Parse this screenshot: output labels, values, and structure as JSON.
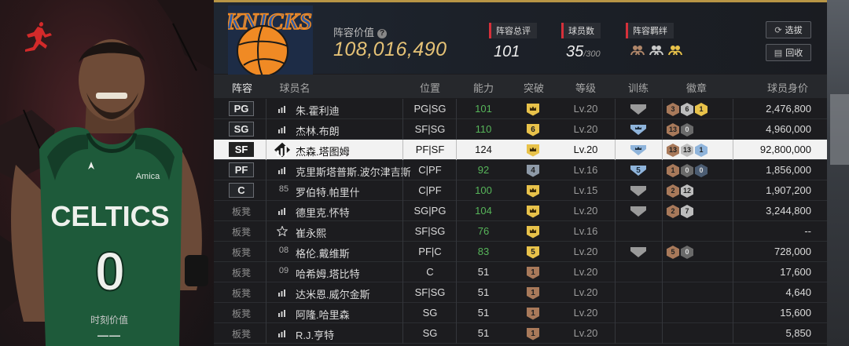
{
  "player_panel": {
    "moment_value_label": "时刻价值",
    "moment_value": "——",
    "jersey_text": "CELTICS",
    "jersey_number": "0",
    "sponsor": "Amica"
  },
  "header": {
    "team_logo_text": "KNICKS",
    "lineup_value_label": "阵容价值",
    "lineup_value": "108,016,490",
    "overall_label": "阵容总评",
    "overall_value": "101",
    "players_label": "球员数",
    "players_count": "35",
    "players_max": "/300",
    "synergy_label": "阵容羁绊",
    "select_button": "选拔",
    "back_button": "回收"
  },
  "columns": [
    "阵容",
    "球员名",
    "位置",
    "能力",
    "突破",
    "等级",
    "训练",
    "徽章",
    "球员身价"
  ],
  "rows": [
    {
      "slot": "PG",
      "slot_type": "starter",
      "icon": "tier",
      "name": "朱.霍利迪",
      "position": "PG|SG",
      "ability": "101",
      "ability_green": true,
      "breakthrough": "",
      "bt_color": "gold",
      "level": "Lv.20",
      "train": "",
      "train_color": "gray",
      "badges": [
        {
          "t": "3",
          "c": "bronze"
        },
        {
          "t": "6",
          "c": "silver"
        },
        {
          "t": "1",
          "c": "gold"
        }
      ],
      "price": "2,476,800"
    },
    {
      "slot": "SG",
      "slot_type": "starter",
      "icon": "tier",
      "name": "杰林.布朗",
      "position": "SF|SG",
      "ability": "110",
      "ability_green": true,
      "breakthrough": "6",
      "bt_color": "gold",
      "level": "Lv.20",
      "train": "",
      "train_color": "blue",
      "badges": [
        {
          "t": "13",
          "c": "bronze"
        },
        {
          "t": "0",
          "c": "dark"
        }
      ],
      "price": "4,960,000"
    },
    {
      "slot": "SF",
      "slot_type": "starter",
      "icon": "tier",
      "name": "杰森.塔图姆",
      "position": "PF|SF",
      "ability": "124",
      "ability_green": false,
      "breakthrough": "",
      "bt_color": "gold",
      "level": "Lv.20",
      "train": "",
      "train_color": "blue",
      "badges": [
        {
          "t": "13",
          "c": "bronze"
        },
        {
          "t": "13",
          "c": "silver"
        },
        {
          "t": "1",
          "c": "blue"
        }
      ],
      "price": "92,800,000"
    },
    {
      "slot": "PF",
      "slot_type": "starter",
      "icon": "tier",
      "name": "克里斯塔普斯.波尔津吉斯",
      "position": "C|PF",
      "ability": "92",
      "ability_green": true,
      "breakthrough": "4",
      "bt_color": "slate",
      "level": "Lv.16",
      "train": "5",
      "train_color": "blue",
      "badges": [
        {
          "t": "1",
          "c": "bronze"
        },
        {
          "t": "0",
          "c": "dark"
        },
        {
          "t": "0",
          "c": "darkblue"
        }
      ],
      "price": "1,856,000"
    },
    {
      "slot": "C",
      "slot_type": "starter",
      "icon": "85",
      "name": "罗伯特.帕里什",
      "position": "C|PF",
      "ability": "100",
      "ability_green": true,
      "breakthrough": "",
      "bt_color": "gold",
      "level": "Lv.15",
      "train": "",
      "train_color": "gray",
      "badges": [
        {
          "t": "2",
          "c": "bronze"
        },
        {
          "t": "12",
          "c": "silver"
        }
      ],
      "price": "1,907,200"
    },
    {
      "slot": "板凳",
      "slot_type": "bench",
      "icon": "tier",
      "name": "德里克.怀特",
      "position": "SG|PG",
      "ability": "104",
      "ability_green": true,
      "breakthrough": "",
      "bt_color": "gold",
      "level": "Lv.20",
      "train": "",
      "train_color": "gray",
      "badges": [
        {
          "t": "2",
          "c": "bronze"
        },
        {
          "t": "7",
          "c": "silver"
        }
      ],
      "price": "3,244,800"
    },
    {
      "slot": "板凳",
      "slot_type": "bench",
      "icon": "star",
      "name": "崔永熙",
      "position": "SF|SG",
      "ability": "76",
      "ability_green": true,
      "breakthrough": "",
      "bt_color": "gold",
      "level": "Lv.16",
      "train": "",
      "train_color": "none",
      "badges": [],
      "price": "--"
    },
    {
      "slot": "板凳",
      "slot_type": "bench",
      "icon": "08",
      "name": "格伦.戴维斯",
      "position": "PF|C",
      "ability": "83",
      "ability_green": true,
      "breakthrough": "5",
      "bt_color": "gold",
      "level": "Lv.20",
      "train": "",
      "train_color": "gray",
      "badges": [
        {
          "t": "5",
          "c": "bronze"
        },
        {
          "t": "0",
          "c": "dark"
        }
      ],
      "price": "728,000"
    },
    {
      "slot": "板凳",
      "slot_type": "bench",
      "icon": "09",
      "name": "哈希姆.塔比特",
      "position": "C",
      "ability": "51",
      "ability_green": false,
      "breakthrough": "1",
      "bt_color": "bronze",
      "level": "Lv.20",
      "train": "",
      "train_color": "none",
      "badges": [],
      "price": "17,600"
    },
    {
      "slot": "板凳",
      "slot_type": "bench",
      "icon": "tier",
      "name": "达米恩.威尔金斯",
      "position": "SF|SG",
      "ability": "51",
      "ability_green": false,
      "breakthrough": "1",
      "bt_color": "bronze",
      "level": "Lv.20",
      "train": "",
      "train_color": "none",
      "badges": [],
      "price": "4,640"
    },
    {
      "slot": "板凳",
      "slot_type": "bench",
      "icon": "tier",
      "name": "阿隆.哈里森",
      "position": "SG",
      "ability": "51",
      "ability_green": false,
      "breakthrough": "1",
      "bt_color": "bronze",
      "level": "Lv.20",
      "train": "",
      "train_color": "none",
      "badges": [],
      "price": "15,600"
    },
    {
      "slot": "板凳",
      "slot_type": "bench",
      "icon": "tier",
      "name": "R.J.亨特",
      "position": "SG",
      "ability": "51",
      "ability_green": false,
      "breakthrough": "1",
      "bt_color": "bronze",
      "level": "Lv.20",
      "train": "",
      "train_color": "none",
      "badges": [],
      "price": "5,850"
    }
  ],
  "colors": {
    "gold": "#e8c24a",
    "bronze": "#a8795a",
    "silver": "#bdbdbd",
    "blue": "#8fb4db",
    "slate": "#8e9aa8",
    "dark": "#6a6a6a",
    "darkblue": "#4c5d73",
    "gray_train": "#9a9a9a",
    "accent_red": "#d6303a",
    "value_gold": "#e5c276"
  }
}
